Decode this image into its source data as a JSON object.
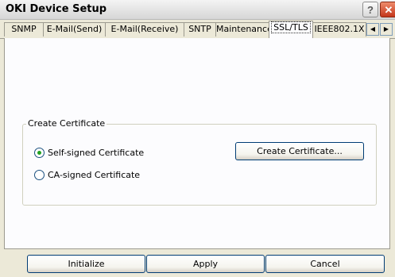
{
  "window": {
    "title": "OKI Device Setup",
    "help_label": "?",
    "close_label": "✕"
  },
  "tabs": [
    {
      "label": "SNMP",
      "active": false
    },
    {
      "label": "E-Mail(Send)",
      "active": false
    },
    {
      "label": "E-Mail(Receive)",
      "active": false
    },
    {
      "label": "SNTP",
      "active": false
    },
    {
      "label": "Maintenance",
      "active": false
    },
    {
      "label": "SSL/TLS",
      "active": true
    },
    {
      "label": "IEEE802.1X",
      "active": false
    }
  ],
  "tab_scroll": {
    "left": "◀",
    "right": "▶"
  },
  "create_certificate": {
    "group_label": "Create Certificate",
    "option_self_signed": "Self-signed Certificate",
    "option_ca_signed": "CA-signed Certificate",
    "selected": "self-signed",
    "create_button": "Create Certificate..."
  },
  "footer": {
    "initialize": "Initialize",
    "apply": "Apply",
    "cancel": "Cancel"
  }
}
